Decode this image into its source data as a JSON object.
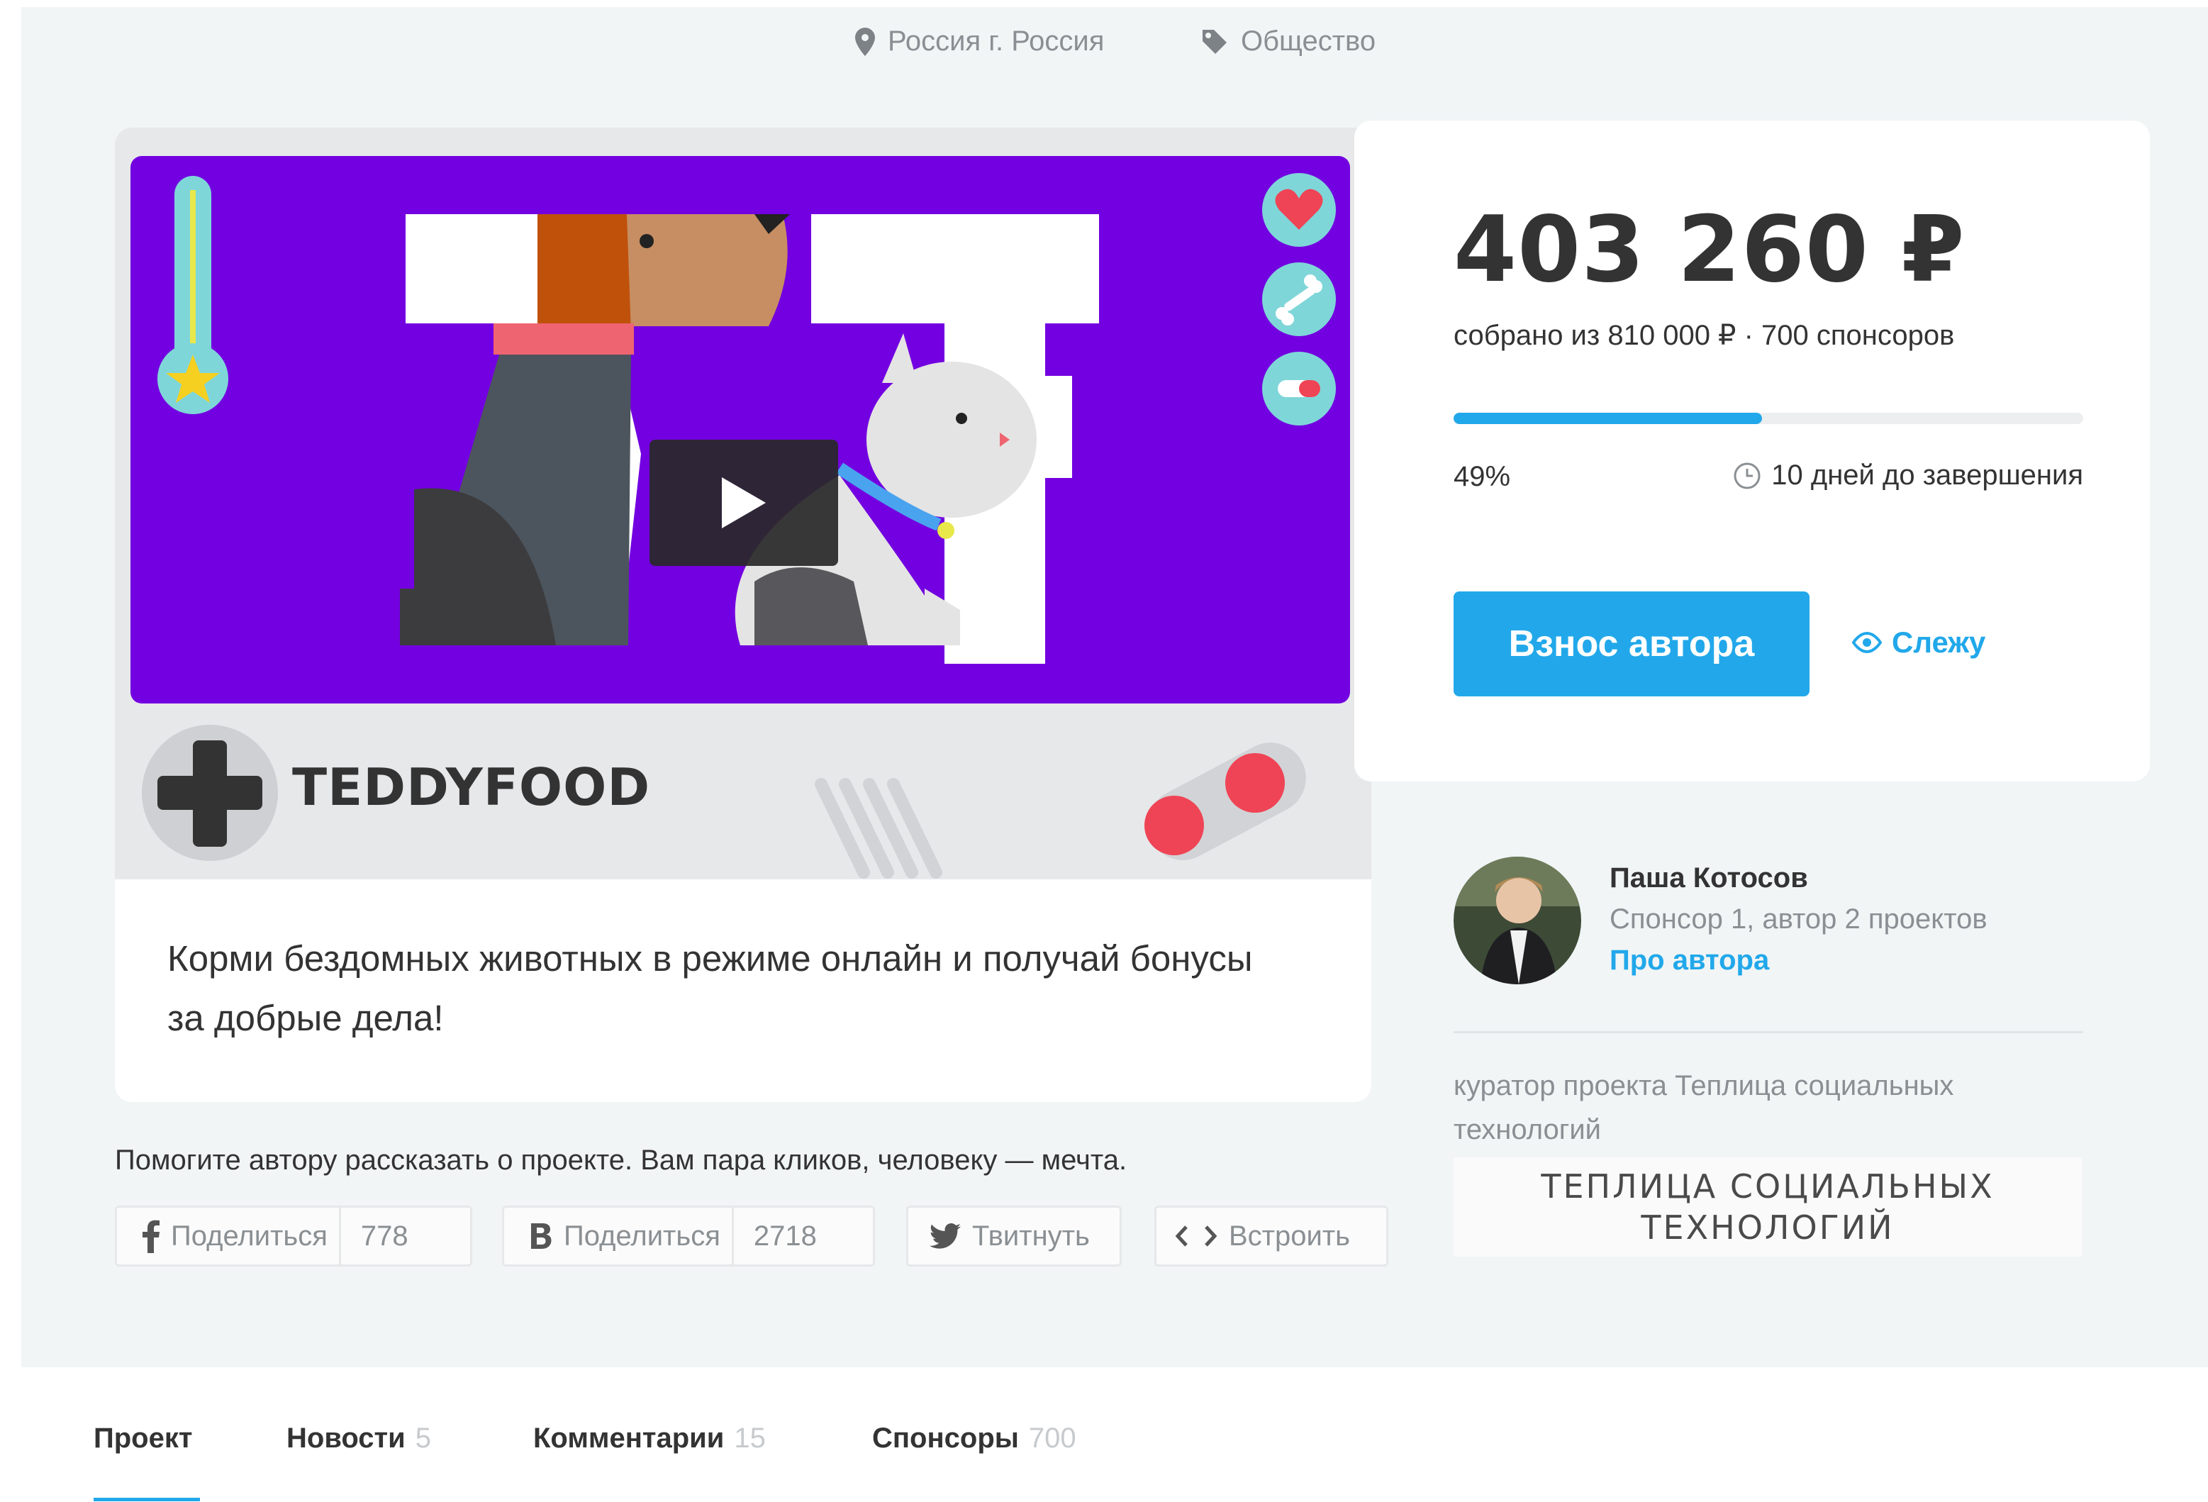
{
  "meta": {
    "location": "Россия г. Россия",
    "category": "Общество",
    "location_icon": "map-pin-icon",
    "category_icon": "tag-icon"
  },
  "project": {
    "brand": "TEDDYFOOD",
    "description": "Корми бездомных животных в режиме онлайн и получай бонусы за добрые дела!"
  },
  "funding": {
    "amount": "403 260 ₽",
    "collected_text": "собрано из 810 000 ₽ · 700 спонсоров",
    "progress_fraction": 0.49,
    "percent": "49%",
    "days_left": "10 дней до завершения",
    "donate_label": "Взнос автора",
    "follow_label": "Слежу"
  },
  "author": {
    "name": "Паша Котосов",
    "meta": "Спонсор 1, автор 2 проектов",
    "link": "Про автора"
  },
  "curator": {
    "text": "куратор проекта Теплица социальных технологий",
    "logo_line1": "ТЕПЛИЦА СОЦИАЛЬНЫХ",
    "logo_line2": "ТЕХНОЛОГИЙ"
  },
  "share": {
    "prompt": "Помогите автору рассказать о проекте. Вам пара кликов, человеку — мечта.",
    "facebook_label": "Поделиться",
    "facebook_count": "778",
    "vk_label": "Поделиться",
    "vk_count": "2718",
    "twitter_label": "Твитнуть",
    "embed_label": "Встроить"
  },
  "tabs": [
    {
      "label": "Проект",
      "count": ""
    },
    {
      "label": "Новости",
      "count": "5"
    },
    {
      "label": "Комментарии",
      "count": "15"
    },
    {
      "label": "Спонсоры",
      "count": "700"
    }
  ],
  "colors": {
    "accent": "#21a8ea",
    "video_bg": "#7300e0",
    "page_bg": "#f1f5f6"
  }
}
